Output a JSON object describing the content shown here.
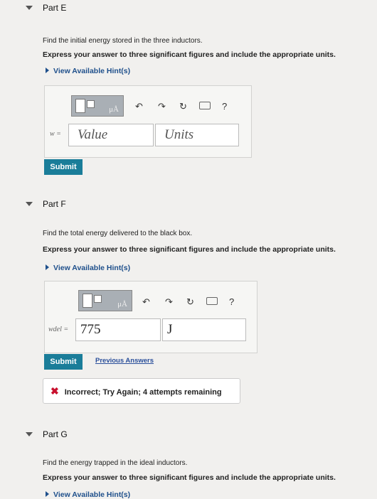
{
  "part_e": {
    "title": "Part E",
    "question": "Find the initial energy stored in the three inductors.",
    "instruction": "Express your answer to three significant figures and include the appropriate units.",
    "hint_link": "View Available Hint(s)",
    "var_label": "w =",
    "value_placeholder": "Value",
    "units_placeholder": "Units",
    "submit": "Submit"
  },
  "part_f": {
    "title": "Part F",
    "question": "Find the total energy delivered to the black box.",
    "instruction": "Express your answer to three significant figures and include the appropriate units.",
    "hint_link": "View Available Hint(s)",
    "var_label": "wdel =",
    "value": "775",
    "units": "J",
    "submit": "Submit",
    "previous_answers": "Previous Answers",
    "feedback": "Incorrect; Try Again; 4 attempts remaining"
  },
  "part_g": {
    "title": "Part G",
    "question": "Find the energy trapped in the ideal inductors.",
    "instruction": "Express your answer to three significant figures and include the appropriate units.",
    "hint_link": "View Available Hint(s)"
  },
  "toolbar": {
    "units_symbol": "μÅ",
    "help": "?"
  },
  "icons": [
    "caret-down-icon",
    "template-icon",
    "undo-icon",
    "redo-icon",
    "reset-icon",
    "keyboard-icon",
    "help-icon",
    "x-mark-icon"
  ],
  "colors": {
    "submit": "#1a7d99",
    "link": "#2a4f9b",
    "error": "#c8102e"
  }
}
